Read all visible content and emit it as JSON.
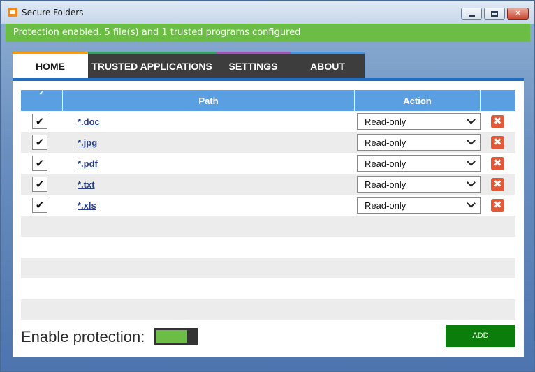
{
  "window": {
    "title": "Secure Folders",
    "minimize_icon": "minimize-icon",
    "maximize_icon": "maximize-icon",
    "close_glyph": "✕"
  },
  "status": {
    "text": "Protection enabled. 5 file(s) and 1 trusted programs configured",
    "color": "#6cbd45"
  },
  "tabs": [
    {
      "label": "HOME",
      "active": true,
      "accent": "#f0a01d"
    },
    {
      "label": "TRUSTED APPLICATIONS",
      "active": false,
      "accent": "#3a9e6a"
    },
    {
      "label": "SETTINGS",
      "active": false,
      "accent": "#9b59b6"
    },
    {
      "label": "ABOUT",
      "active": false,
      "accent": "#4a90d9"
    }
  ],
  "grid": {
    "columns": {
      "check": "",
      "path": "Path",
      "action": "Action",
      "delete": ""
    },
    "rows": [
      {
        "checked": true,
        "check_glyph": "✔",
        "path": "*.doc",
        "action": "Read-only",
        "delete_glyph": "✖"
      },
      {
        "checked": true,
        "check_glyph": "✔",
        "path": "*.jpg",
        "action": "Read-only",
        "delete_glyph": "✖"
      },
      {
        "checked": true,
        "check_glyph": "✔",
        "path": "*.pdf",
        "action": "Read-only",
        "delete_glyph": "✖"
      },
      {
        "checked": true,
        "check_glyph": "✔",
        "path": "*.txt",
        "action": "Read-only",
        "delete_glyph": "✖"
      },
      {
        "checked": true,
        "check_glyph": "✔",
        "path": "*.xls",
        "action": "Read-only",
        "delete_glyph": "✖"
      }
    ],
    "header_color": "#5b9fe3"
  },
  "footer": {
    "enable_label": "Enable protection:",
    "protection_enabled": true,
    "add_label": "ADD",
    "add_color": "#0a7d0a"
  }
}
